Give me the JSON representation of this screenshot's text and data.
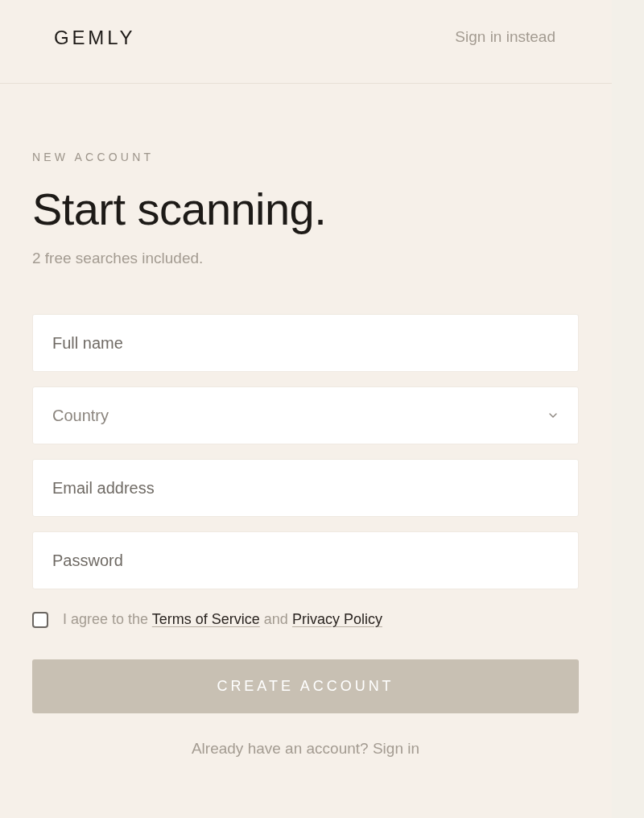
{
  "header": {
    "logo": "GEMLY",
    "sign_in_link": "Sign in instead"
  },
  "intro": {
    "eyebrow": "NEW ACCOUNT",
    "title": "Start scanning.",
    "subtitle": "2 free searches included."
  },
  "form": {
    "fields": [
      {
        "kind": "text",
        "placeholder": "Full name"
      },
      {
        "kind": "select",
        "placeholder": "Country"
      },
      {
        "kind": "email",
        "placeholder": "Email address"
      },
      {
        "kind": "password",
        "placeholder": "Password"
      }
    ],
    "agreement": {
      "checked": false,
      "parts": [
        {
          "kind": "text",
          "text": "I agree to the"
        },
        {
          "kind": "link",
          "text": "Terms of Service"
        },
        {
          "kind": "text",
          "text": "and"
        },
        {
          "kind": "link",
          "text": "Privacy Policy"
        }
      ]
    },
    "submit": {
      "label": "CREATE ACCOUNT",
      "disabled": true
    }
  },
  "footer": {
    "text": "Already have an account?",
    "link": "Sign in"
  }
}
